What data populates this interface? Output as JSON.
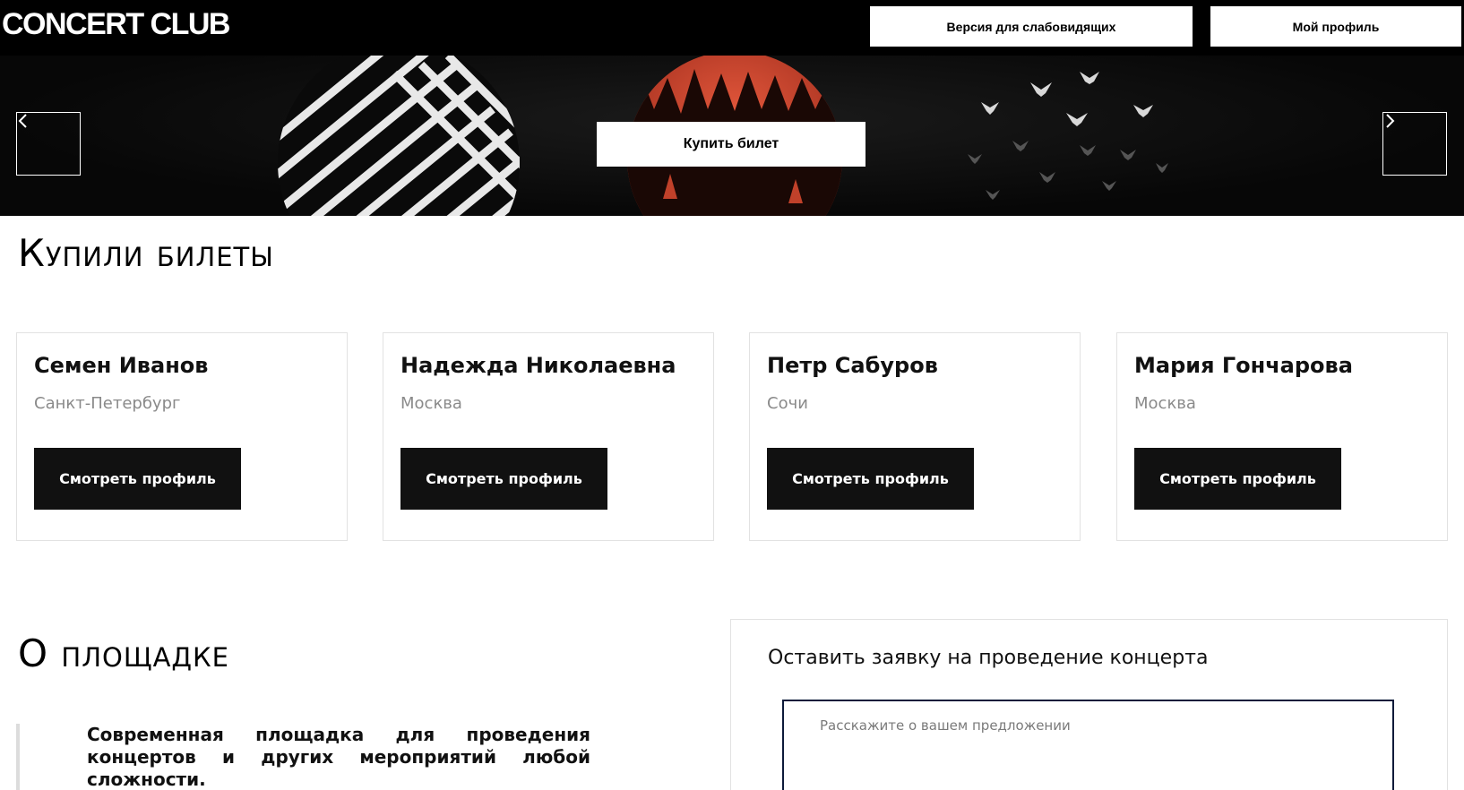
{
  "header": {
    "logo": "CONCERT CLUB",
    "accessibility_label": "Версия для слабовидящих",
    "profile_label": "Мой профиль"
  },
  "hero": {
    "buy_label": "Купить билет",
    "prev_icon": "chevron-left-icon",
    "next_icon": "chevron-right-icon"
  },
  "buyers": {
    "title": "Купили билеты",
    "cards": [
      {
        "name": "Семен Иванов",
        "city": "Санкт-Петербург",
        "button": "Смотреть профиль"
      },
      {
        "name": "Надежда Николаевна",
        "city": "Москва",
        "button": "Смотреть профиль"
      },
      {
        "name": "Петр Сабуров",
        "city": "Сочи",
        "button": "Смотреть профиль"
      },
      {
        "name": "Мария Гончарова",
        "city": "Москва",
        "button": "Смотреть профиль"
      }
    ]
  },
  "about": {
    "title": "О площадке",
    "text": "Современная площадка для проведения концертов и других мероприятий любой сложности."
  },
  "request": {
    "title": "Оставить заявку на проведение концерта",
    "placeholder": "Расскажите о вашем предложении"
  },
  "colors": {
    "header_bg": "#000000",
    "button_dark": "#111111",
    "accent_red": "#d9472f",
    "textarea_border": "#0c1a3a"
  }
}
